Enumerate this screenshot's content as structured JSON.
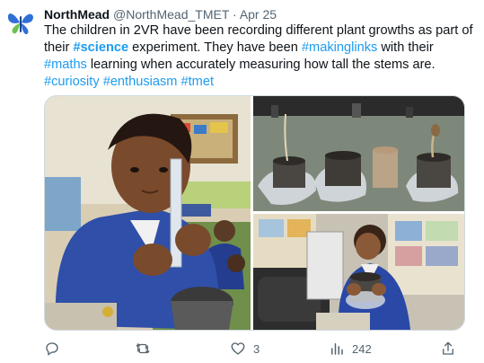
{
  "tweet": {
    "author_name": "NorthMead",
    "handle": "@NorthMead_TMET",
    "separator": "·",
    "date": "Apr 25",
    "text": {
      "part1": "The children in 2VR have been recording different  plant growths as part of their ",
      "tag_science": "#science",
      "part2": " experiment. They have been ",
      "tag_makinglinks": "#makinglinks",
      "part3": " with their ",
      "tag_maths": "#maths",
      "part4": " learning when accurately measuring how tall the stems are.",
      "tag_curiosity": "#curiosity",
      "tag_enthusiasm": "#enthusiasm",
      "tag_tmet": "#tmet"
    }
  },
  "actions": {
    "reply": {
      "icon": "reply-icon",
      "count": ""
    },
    "retweet": {
      "icon": "retweet-icon",
      "count": ""
    },
    "like": {
      "icon": "heart-icon",
      "count": "3"
    },
    "views": {
      "icon": "views-icon",
      "count": "242"
    },
    "share": {
      "icon": "share-icon"
    }
  },
  "colors": {
    "accent": "#1d9bf0",
    "text": "#0f1419",
    "muted": "#536471",
    "logo_blue": "#2f6fd6",
    "logo_green": "#6cc24a"
  }
}
